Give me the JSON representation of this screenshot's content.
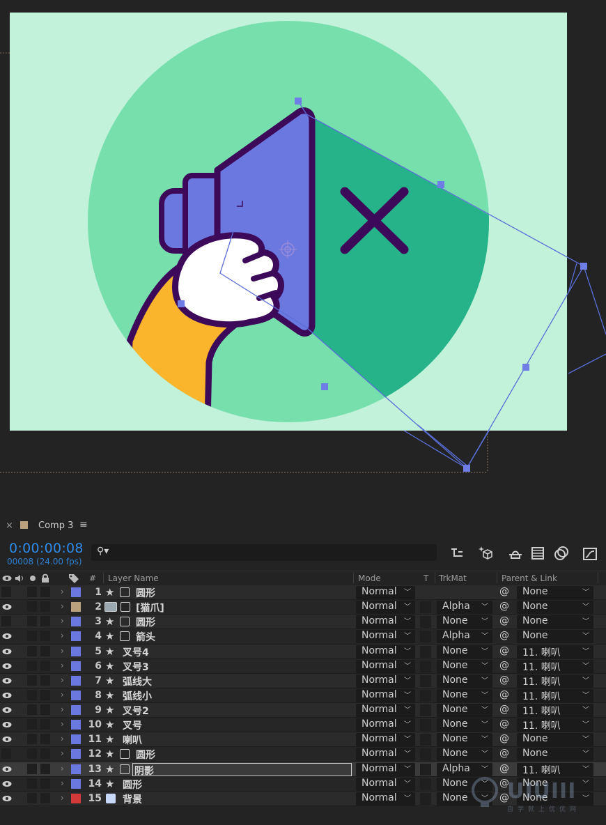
{
  "panel": {
    "close_glyph": "×",
    "tab_label": "Comp 3",
    "menu_glyph": "≡",
    "tab_color": "#b9a27c"
  },
  "time": {
    "timecode": "0:00:00:08",
    "frames": "00008 (24.00 fps)",
    "search_glyph": "⚲▾"
  },
  "columns": {
    "hash": "#",
    "layer_name": "Layer Name",
    "mode": "Mode",
    "t": "T",
    "trkmat": "TrkMat",
    "parent": "Parent & Link"
  },
  "layers": [
    {
      "num": "1",
      "name": "圆形",
      "type": "shape",
      "label_color": "#6b78e0",
      "eye": false,
      "mode": "Normal",
      "trkmat": "",
      "parent": "None"
    },
    {
      "num": "2",
      "name": "[猫爪]",
      "type": "precomp",
      "label_color": "#b9a27c",
      "eye": true,
      "mode": "Normal",
      "trkmat": "Alpha",
      "parent": "None"
    },
    {
      "num": "3",
      "name": "圆形",
      "type": "shape",
      "label_color": "#6b78e0",
      "eye": false,
      "mode": "Normal",
      "trkmat": "None",
      "parent": "None"
    },
    {
      "num": "4",
      "name": "箭头",
      "type": "shape",
      "label_color": "#6b78e0",
      "eye": true,
      "mode": "Normal",
      "trkmat": "Alpha",
      "parent": "None"
    },
    {
      "num": "5",
      "name": "叉号4",
      "type": "none",
      "label_color": "#6b78e0",
      "eye": true,
      "mode": "Normal",
      "trkmat": "None",
      "parent": "11. 喇叭"
    },
    {
      "num": "6",
      "name": "叉号3",
      "type": "none",
      "label_color": "#6b78e0",
      "eye": true,
      "mode": "Normal",
      "trkmat": "None",
      "parent": "11. 喇叭"
    },
    {
      "num": "7",
      "name": "弧线大",
      "type": "none",
      "label_color": "#6b78e0",
      "eye": true,
      "mode": "Normal",
      "trkmat": "None",
      "parent": "11. 喇叭"
    },
    {
      "num": "8",
      "name": "弧线小",
      "type": "none",
      "label_color": "#6b78e0",
      "eye": true,
      "mode": "Normal",
      "trkmat": "None",
      "parent": "11. 喇叭"
    },
    {
      "num": "9",
      "name": "叉号2",
      "type": "none",
      "label_color": "#6b78e0",
      "eye": true,
      "mode": "Normal",
      "trkmat": "None",
      "parent": "11. 喇叭"
    },
    {
      "num": "10",
      "name": "叉号",
      "type": "none",
      "label_color": "#6b78e0",
      "eye": true,
      "mode": "Normal",
      "trkmat": "None",
      "parent": "11. 喇叭"
    },
    {
      "num": "11",
      "name": "喇叭",
      "type": "none",
      "label_color": "#6b78e0",
      "eye": true,
      "mode": "Normal",
      "trkmat": "None",
      "parent": "None"
    },
    {
      "num": "12",
      "name": "圆形",
      "type": "shape",
      "label_color": "#6b78e0",
      "eye": false,
      "mode": "Normal",
      "trkmat": "None",
      "parent": "None"
    },
    {
      "num": "13",
      "name": "阴影",
      "type": "shape",
      "label_color": "#6b78e0",
      "eye": true,
      "mode": "Normal",
      "trkmat": "Alpha",
      "parent": "11. 喇叭",
      "selected": true
    },
    {
      "num": "14",
      "name": "圆形",
      "type": "none",
      "label_color": "#6b78e0",
      "eye": true,
      "mode": "Normal",
      "trkmat": "None",
      "parent": "None"
    },
    {
      "num": "15",
      "name": "背景",
      "type": "solid",
      "label_color": "#d23a3a",
      "eye": true,
      "mode": "Normal",
      "trkmat": "None",
      "parent": "None"
    }
  ],
  "watermark": {
    "text": "UIUIII",
    "sub": "自学就上优优网"
  },
  "colors": {
    "canvas_bg": "#c2f2da",
    "circle": "#76dfac",
    "shadow": "#27b38a",
    "speaker": "#6b78e0",
    "outline": "#3d0a5a",
    "paw": "#ffffff",
    "arm": "#fbb52d",
    "timecode": "#2d8ceb"
  }
}
